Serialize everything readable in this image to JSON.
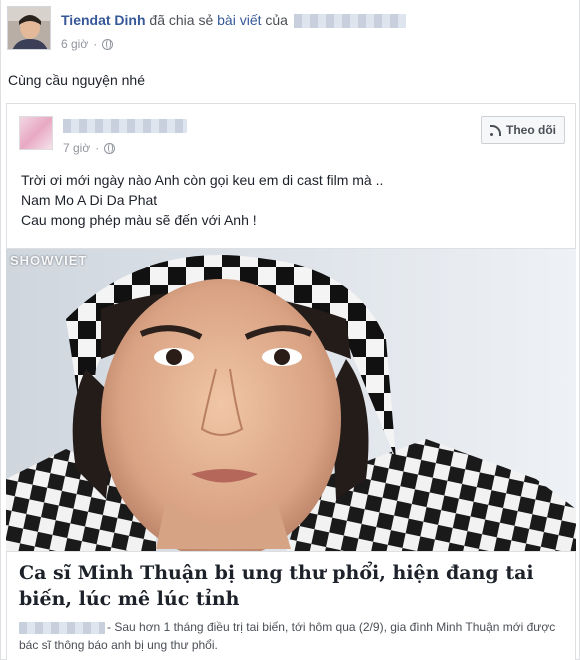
{
  "post": {
    "author_name": "Tiendat Dinh",
    "shared_text": "đã chia sẻ",
    "link_text": "bài viết",
    "of_text": "của",
    "time": "6 giờ",
    "caption": "Cùng cầu nguyện nhé"
  },
  "shared_post": {
    "time": "7 giờ",
    "follow_label": "Theo dõi",
    "lines": [
      "Trời ơi mới ngày nào Anh còn gọi keu em di cast film mà ..",
      "Nam Mo A Di Da Phat",
      "Cau mong phép màu sẽ đến với Anh !"
    ],
    "photo_watermark": "SHOWVIET"
  },
  "article": {
    "title": "Ca sĩ Minh Thuận bị ung thư phổi, hiện đang tai biến, lúc mê lúc tỉnh",
    "description": "- Sau hơn 1 tháng điều trị tai biến, tới hôm qua (2/9), gia đình Minh Thuận mới được bác sĩ thông báo anh bị ung thư phổi."
  },
  "colors": {
    "link_blue": "#365899",
    "meta_gray": "#90949c",
    "border": "#dddfe2"
  },
  "icons": {
    "privacy": "globe-icon",
    "follow": "rss-icon"
  }
}
